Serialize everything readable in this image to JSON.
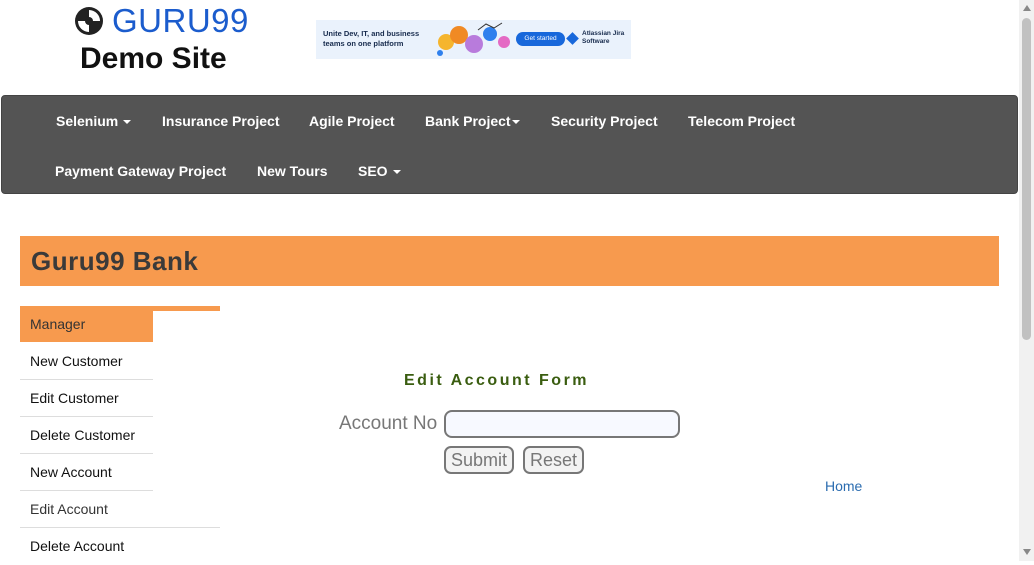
{
  "logo": {
    "brand": "GURU99",
    "subtitle": "Demo Site"
  },
  "ad": {
    "text": "Unite Dev, IT, and business teams on one platform",
    "button": "Get started",
    "brand": "Atlassian Jira Software"
  },
  "nav": {
    "items": [
      {
        "label": "Selenium",
        "dropdown": true
      },
      {
        "label": "Insurance Project",
        "dropdown": false
      },
      {
        "label": "Agile Project",
        "dropdown": false
      },
      {
        "label": "Bank Project",
        "dropdown": true
      },
      {
        "label": "Security Project",
        "dropdown": false
      },
      {
        "label": "Telecom Project",
        "dropdown": false
      },
      {
        "label": "Payment Gateway Project",
        "dropdown": false
      },
      {
        "label": "New Tours",
        "dropdown": false
      },
      {
        "label": "SEO",
        "dropdown": true
      }
    ]
  },
  "bank": {
    "title": "Guru99 Bank"
  },
  "sidebar": {
    "items": [
      {
        "label": "Manager"
      },
      {
        "label": "New Customer"
      },
      {
        "label": "Edit Customer"
      },
      {
        "label": "Delete Customer"
      },
      {
        "label": "New Account"
      },
      {
        "label": "Edit Account"
      },
      {
        "label": "Delete Account"
      }
    ]
  },
  "form": {
    "title": "Edit Account Form",
    "account_label": "Account No",
    "account_value": "",
    "submit": "Submit",
    "reset": "Reset"
  },
  "links": {
    "home": "Home"
  },
  "colors": {
    "accent": "#f79a4e",
    "navbar": "#545454",
    "brand": "#1b5ccd",
    "form_title": "#3a5d10"
  }
}
